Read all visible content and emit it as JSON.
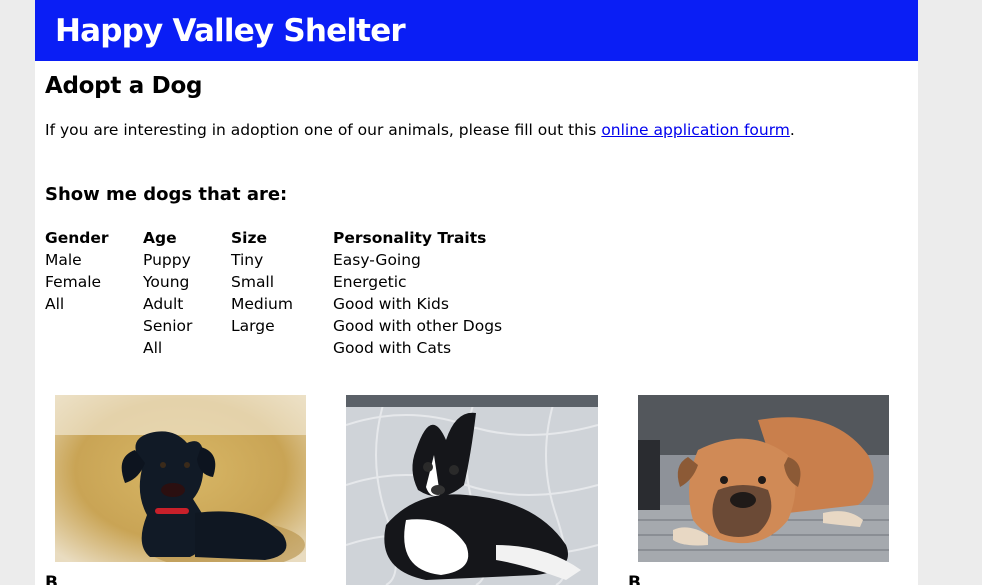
{
  "header": {
    "site_title": "Happy Valley Shelter"
  },
  "main": {
    "page_title": "Adopt a Dog",
    "intro_text": "If you are interesting in adoption one of our animals, please fill out this ",
    "intro_link": "online application fourm",
    "intro_end": ".",
    "filters_title": "Show me dogs that are:"
  },
  "filters": {
    "gender": {
      "heading": "Gender",
      "options": [
        "Male",
        "Female",
        "All"
      ]
    },
    "age": {
      "heading": "Age",
      "options": [
        "Puppy",
        "Young",
        "Adult",
        "Senior",
        "All"
      ]
    },
    "size": {
      "heading": "Size",
      "options": [
        "Tiny",
        "Small",
        "Medium",
        "Large"
      ]
    },
    "traits": {
      "heading": "Personality Traits",
      "options": [
        "Easy-Going",
        "Energetic",
        "Good with Kids",
        "Good with other Dogs",
        "Good with Cats"
      ]
    }
  },
  "dogs": [
    {
      "photo": "black-terrier-on-gravel",
      "name": "B"
    },
    {
      "photo": "boston-terrier-on-tiles",
      "name": ""
    },
    {
      "photo": "bulldog-on-porch",
      "name": "B"
    }
  ],
  "colors": {
    "banner": "#0a1ef5",
    "link": "#0000ee"
  }
}
